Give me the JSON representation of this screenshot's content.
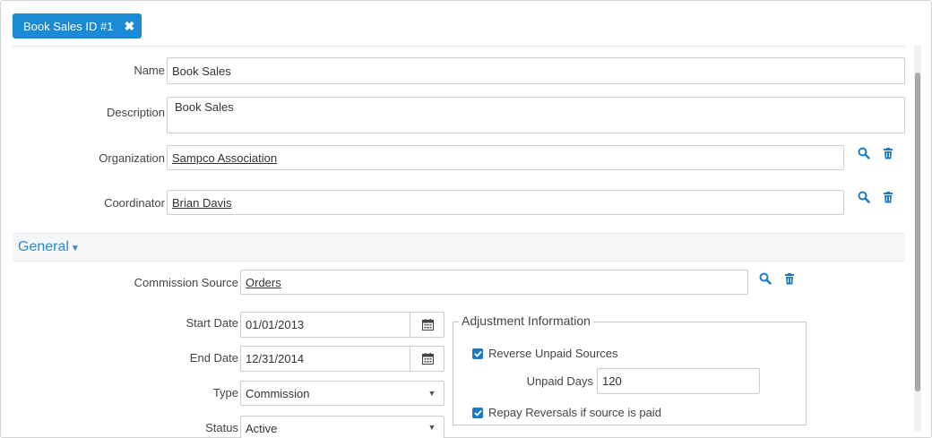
{
  "tab": {
    "label": "Book Sales ID #1"
  },
  "form": {
    "name_label": "Name",
    "name_value": "Book Sales",
    "description_label": "Description",
    "description_value": "Book Sales",
    "organization_label": "Organization",
    "organization_value": "Sampco Association",
    "coordinator_label": "Coordinator",
    "coordinator_value": "Brian Davis"
  },
  "section": {
    "title": "General"
  },
  "general": {
    "commission_source_label": "Commission Source",
    "commission_source_value": "Orders",
    "start_date_label": "Start Date",
    "start_date_value": "01/01/2013",
    "end_date_label": "End Date",
    "end_date_value": "12/31/2014",
    "type_label": "Type",
    "type_value": "Commission",
    "status_label": "Status",
    "status_value": "Active"
  },
  "adjustment": {
    "legend": "Adjustment Information",
    "reverse_unpaid_label": "Reverse Unpaid Sources",
    "reverse_unpaid_checked": true,
    "unpaid_days_label": "Unpaid Days",
    "unpaid_days_value": "120",
    "repay_reversals_label": "Repay Reversals if source is paid",
    "repay_reversals_checked": true
  },
  "colors": {
    "accent": "#1a8ad4",
    "link_icon": "#1a7bc4",
    "section_title": "#2b8ad2"
  },
  "icons": [
    "close-icon",
    "search-icon",
    "trash-icon",
    "calendar-icon",
    "caret-down-icon",
    "checkmark-icon"
  ]
}
